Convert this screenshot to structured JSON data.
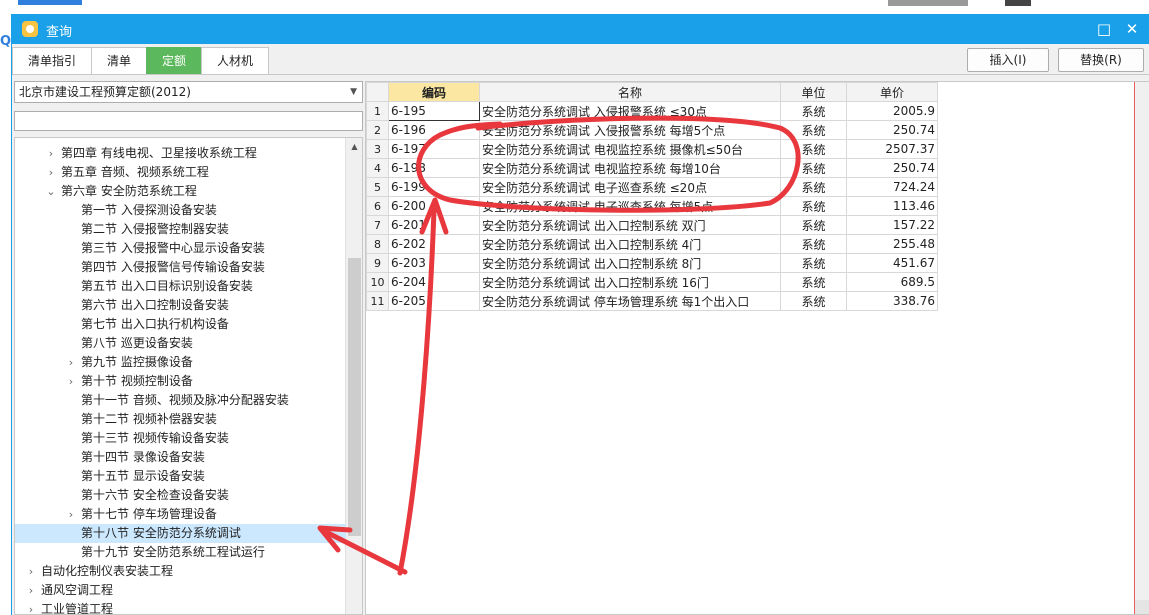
{
  "window": {
    "title": "查询",
    "maximize_glyph": "□",
    "close_glyph": "✕"
  },
  "tabs": [
    {
      "label": "清单指引",
      "active": false
    },
    {
      "label": "清单",
      "active": false
    },
    {
      "label": "定额",
      "active": true
    },
    {
      "label": "人材机",
      "active": false
    }
  ],
  "actions": {
    "insert_label": "插入(I)",
    "replace_label": "替换(R)"
  },
  "quota_library": {
    "selected": "北京市建设工程预算定额(2012)",
    "filter_value": ""
  },
  "tree": [
    {
      "label": "第四章 有线电视、卫星接收系统工程",
      "level": 1,
      "chevron": "›",
      "selected": false
    },
    {
      "label": "第五章 音频、视频系统工程",
      "level": 1,
      "chevron": "›",
      "selected": false
    },
    {
      "label": "第六章 安全防范系统工程",
      "level": 1,
      "chevron": "⌄",
      "selected": false
    },
    {
      "label": "第一节 入侵探测设备安装",
      "level": 2,
      "chevron": "",
      "selected": false
    },
    {
      "label": "第二节 入侵报警控制器安装",
      "level": 2,
      "chevron": "",
      "selected": false
    },
    {
      "label": "第三节 入侵报警中心显示设备安装",
      "level": 2,
      "chevron": "",
      "selected": false
    },
    {
      "label": "第四节 入侵报警信号传输设备安装",
      "level": 2,
      "chevron": "",
      "selected": false
    },
    {
      "label": "第五节 出入口目标识别设备安装",
      "level": 2,
      "chevron": "",
      "selected": false
    },
    {
      "label": "第六节 出入口控制设备安装",
      "level": 2,
      "chevron": "",
      "selected": false
    },
    {
      "label": "第七节 出入口执行机构设备",
      "level": 2,
      "chevron": "",
      "selected": false
    },
    {
      "label": "第八节 巡更设备安装",
      "level": 2,
      "chevron": "",
      "selected": false
    },
    {
      "label": "第九节 监控摄像设备",
      "level": 2,
      "chevron": "›",
      "selected": false
    },
    {
      "label": "第十节 视频控制设备",
      "level": 2,
      "chevron": "›",
      "selected": false
    },
    {
      "label": "第十一节 音频、视频及脉冲分配器安装",
      "level": 2,
      "chevron": "",
      "selected": false
    },
    {
      "label": "第十二节 视频补偿器安装",
      "level": 2,
      "chevron": "",
      "selected": false
    },
    {
      "label": "第十三节 视频传输设备安装",
      "level": 2,
      "chevron": "",
      "selected": false
    },
    {
      "label": "第十四节 录像设备安装",
      "level": 2,
      "chevron": "",
      "selected": false
    },
    {
      "label": "第十五节 显示设备安装",
      "level": 2,
      "chevron": "",
      "selected": false
    },
    {
      "label": "第十六节 安全检查设备安装",
      "level": 2,
      "chevron": "",
      "selected": false
    },
    {
      "label": "第十七节 停车场管理设备",
      "level": 2,
      "chevron": "›",
      "selected": false
    },
    {
      "label": "第十八节 安全防范分系统调试",
      "level": 2,
      "chevron": "",
      "selected": true
    },
    {
      "label": "第十九节 安全防范系统工程试运行",
      "level": 2,
      "chevron": "",
      "selected": false
    },
    {
      "label": "自动化控制仪表安装工程",
      "level": 0,
      "chevron": "›",
      "selected": false
    },
    {
      "label": "通风空调工程",
      "level": 0,
      "chevron": "›",
      "selected": false
    },
    {
      "label": "工业管道工程",
      "level": 0,
      "chevron": "›",
      "selected": false
    }
  ],
  "grid": {
    "headers": {
      "code": "编码",
      "name": "名称",
      "unit": "单位",
      "price": "单价"
    },
    "rows": [
      {
        "no": "1",
        "code": "6-195",
        "name": "安全防范分系统调试 入侵报警系统 ≤30点",
        "unit": "系统",
        "price": "2005.9"
      },
      {
        "no": "2",
        "code": "6-196",
        "name": "安全防范分系统调试 入侵报警系统 每增5个点",
        "unit": "系统",
        "price": "250.74"
      },
      {
        "no": "3",
        "code": "6-197",
        "name": "安全防范分系统调试 电视监控系统 摄像机≤50台",
        "unit": "系统",
        "price": "2507.37"
      },
      {
        "no": "4",
        "code": "6-198",
        "name": "安全防范分系统调试 电视监控系统 每增10台",
        "unit": "系统",
        "price": "250.74"
      },
      {
        "no": "5",
        "code": "6-199",
        "name": "安全防范分系统调试 电子巡查系统 ≤20点",
        "unit": "系统",
        "price": "724.24"
      },
      {
        "no": "6",
        "code": "6-200",
        "name": "安全防范分系统调试 电子巡查系统 每增5点",
        "unit": "系统",
        "price": "113.46"
      },
      {
        "no": "7",
        "code": "6-201",
        "name": "安全防范分系统调试 出入口控制系统 双门",
        "unit": "系统",
        "price": "157.22"
      },
      {
        "no": "8",
        "code": "6-202",
        "name": "安全防范分系统调试 出入口控制系统 4门",
        "unit": "系统",
        "price": "255.48"
      },
      {
        "no": "9",
        "code": "6-203",
        "name": "安全防范分系统调试 出入口控制系统 8门",
        "unit": "系统",
        "price": "451.67"
      },
      {
        "no": "10",
        "code": "6-204",
        "name": "安全防范分系统调试 出入口控制系统 16门",
        "unit": "系统",
        "price": "689.5"
      },
      {
        "no": "11",
        "code": "6-205",
        "name": "安全防范分系统调试 停车场管理系统 每1个出入口",
        "unit": "系统",
        "price": "338.76"
      }
    ]
  },
  "colors": {
    "titlebar": "#1aa0e8",
    "active_tab": "#5cb85c",
    "annotation": "#e8383d",
    "selection": "#cce8ff"
  }
}
